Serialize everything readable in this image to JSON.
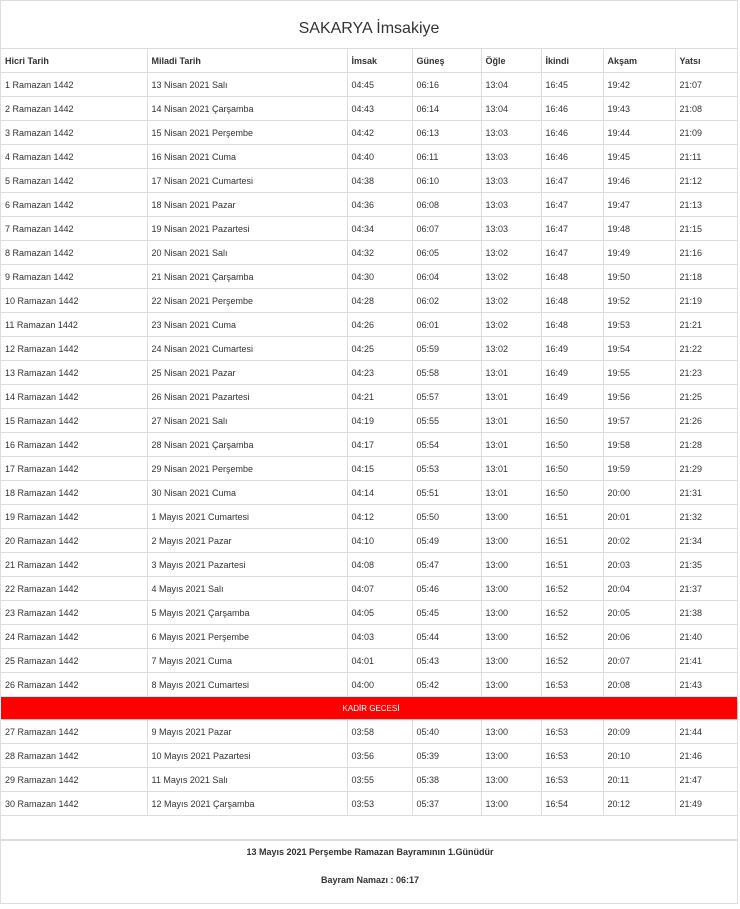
{
  "title": "SAKARYA İmsakiye",
  "columns": [
    "Hicri Tarih",
    "Miladi Tarih",
    "İmsak",
    "Güneş",
    "Öğle",
    "İkindi",
    "Akşam",
    "Yatsı"
  ],
  "rows_before": [
    [
      "1 Ramazan 1442",
      "13 Nisan 2021 Salı",
      "04:45",
      "06:16",
      "13:04",
      "16:45",
      "19:42",
      "21:07"
    ],
    [
      "2 Ramazan 1442",
      "14 Nisan 2021 Çarşamba",
      "04:43",
      "06:14",
      "13:04",
      "16:46",
      "19:43",
      "21:08"
    ],
    [
      "3 Ramazan 1442",
      "15 Nisan 2021 Perşembe",
      "04:42",
      "06:13",
      "13:03",
      "16:46",
      "19:44",
      "21:09"
    ],
    [
      "4 Ramazan 1442",
      "16 Nisan 2021 Cuma",
      "04:40",
      "06:11",
      "13:03",
      "16:46",
      "19:45",
      "21:11"
    ],
    [
      "5 Ramazan 1442",
      "17 Nisan 2021 Cumartesi",
      "04:38",
      "06:10",
      "13:03",
      "16:47",
      "19:46",
      "21:12"
    ],
    [
      "6 Ramazan 1442",
      "18 Nisan 2021 Pazar",
      "04:36",
      "06:08",
      "13:03",
      "16:47",
      "19:47",
      "21:13"
    ],
    [
      "7 Ramazan 1442",
      "19 Nisan 2021 Pazartesi",
      "04:34",
      "06:07",
      "13:03",
      "16:47",
      "19:48",
      "21:15"
    ],
    [
      "8 Ramazan 1442",
      "20 Nisan 2021 Salı",
      "04:32",
      "06:05",
      "13:02",
      "16:47",
      "19:49",
      "21:16"
    ],
    [
      "9 Ramazan 1442",
      "21 Nisan 2021 Çarşamba",
      "04:30",
      "06:04",
      "13:02",
      "16:48",
      "19:50",
      "21:18"
    ],
    [
      "10 Ramazan 1442",
      "22 Nisan 2021 Perşembe",
      "04:28",
      "06:02",
      "13:02",
      "16:48",
      "19:52",
      "21:19"
    ],
    [
      "11 Ramazan 1442",
      "23 Nisan 2021 Cuma",
      "04:26",
      "06:01",
      "13:02",
      "16:48",
      "19:53",
      "21:21"
    ],
    [
      "12 Ramazan 1442",
      "24 Nisan 2021 Cumartesi",
      "04:25",
      "05:59",
      "13:02",
      "16:49",
      "19:54",
      "21:22"
    ],
    [
      "13 Ramazan 1442",
      "25 Nisan 2021 Pazar",
      "04:23",
      "05:58",
      "13:01",
      "16:49",
      "19:55",
      "21:23"
    ],
    [
      "14 Ramazan 1442",
      "26 Nisan 2021 Pazartesi",
      "04:21",
      "05:57",
      "13:01",
      "16:49",
      "19:56",
      "21:25"
    ],
    [
      "15 Ramazan 1442",
      "27 Nisan 2021 Salı",
      "04:19",
      "05:55",
      "13:01",
      "16:50",
      "19:57",
      "21:26"
    ],
    [
      "16 Ramazan 1442",
      "28 Nisan 2021 Çarşamba",
      "04:17",
      "05:54",
      "13:01",
      "16:50",
      "19:58",
      "21:28"
    ],
    [
      "17 Ramazan 1442",
      "29 Nisan 2021 Perşembe",
      "04:15",
      "05:53",
      "13:01",
      "16:50",
      "19:59",
      "21:29"
    ],
    [
      "18 Ramazan 1442",
      "30 Nisan 2021 Cuma",
      "04:14",
      "05:51",
      "13:01",
      "16:50",
      "20:00",
      "21:31"
    ],
    [
      "19 Ramazan 1442",
      "1 Mayıs 2021 Cumartesi",
      "04:12",
      "05:50",
      "13:00",
      "16:51",
      "20:01",
      "21:32"
    ],
    [
      "20 Ramazan 1442",
      "2 Mayıs 2021 Pazar",
      "04:10",
      "05:49",
      "13:00",
      "16:51",
      "20:02",
      "21:34"
    ],
    [
      "21 Ramazan 1442",
      "3 Mayıs 2021 Pazartesi",
      "04:08",
      "05:47",
      "13:00",
      "16:51",
      "20:03",
      "21:35"
    ],
    [
      "22 Ramazan 1442",
      "4 Mayıs 2021 Salı",
      "04:07",
      "05:46",
      "13:00",
      "16:52",
      "20:04",
      "21:37"
    ],
    [
      "23 Ramazan 1442",
      "5 Mayıs 2021 Çarşamba",
      "04:05",
      "05:45",
      "13:00",
      "16:52",
      "20:05",
      "21:38"
    ],
    [
      "24 Ramazan 1442",
      "6 Mayıs 2021 Perşembe",
      "04:03",
      "05:44",
      "13:00",
      "16:52",
      "20:06",
      "21:40"
    ],
    [
      "25 Ramazan 1442",
      "7 Mayıs 2021 Cuma",
      "04:01",
      "05:43",
      "13:00",
      "16:52",
      "20:07",
      "21:41"
    ],
    [
      "26 Ramazan 1442",
      "8 Mayıs 2021 Cumartesi",
      "04:00",
      "05:42",
      "13:00",
      "16:53",
      "20:08",
      "21:43"
    ]
  ],
  "kadir_label": "KADİR GECESİ",
  "rows_after": [
    [
      "27 Ramazan 1442",
      "9 Mayıs 2021 Pazar",
      "03:58",
      "05:40",
      "13:00",
      "16:53",
      "20:09",
      "21:44"
    ],
    [
      "28 Ramazan 1442",
      "10 Mayıs 2021 Pazartesi",
      "03:56",
      "05:39",
      "13:00",
      "16:53",
      "20:10",
      "21:46"
    ],
    [
      "29 Ramazan 1442",
      "11 Mayıs 2021 Salı",
      "03:55",
      "05:38",
      "13:00",
      "16:53",
      "20:11",
      "21:47"
    ],
    [
      "30 Ramazan 1442",
      "12 Mayıs 2021 Çarşamba",
      "03:53",
      "05:37",
      "13:00",
      "16:54",
      "20:12",
      "21:49"
    ]
  ],
  "footer": {
    "bayram_note": "13 Mayıs 2021 Perşembe Ramazan Bayramının 1.Günüdür",
    "bayram_namazi": "Bayram Namazı : 06:17"
  },
  "colors": {
    "kadir_bg": "#ff0000",
    "border": "#dddddd"
  }
}
